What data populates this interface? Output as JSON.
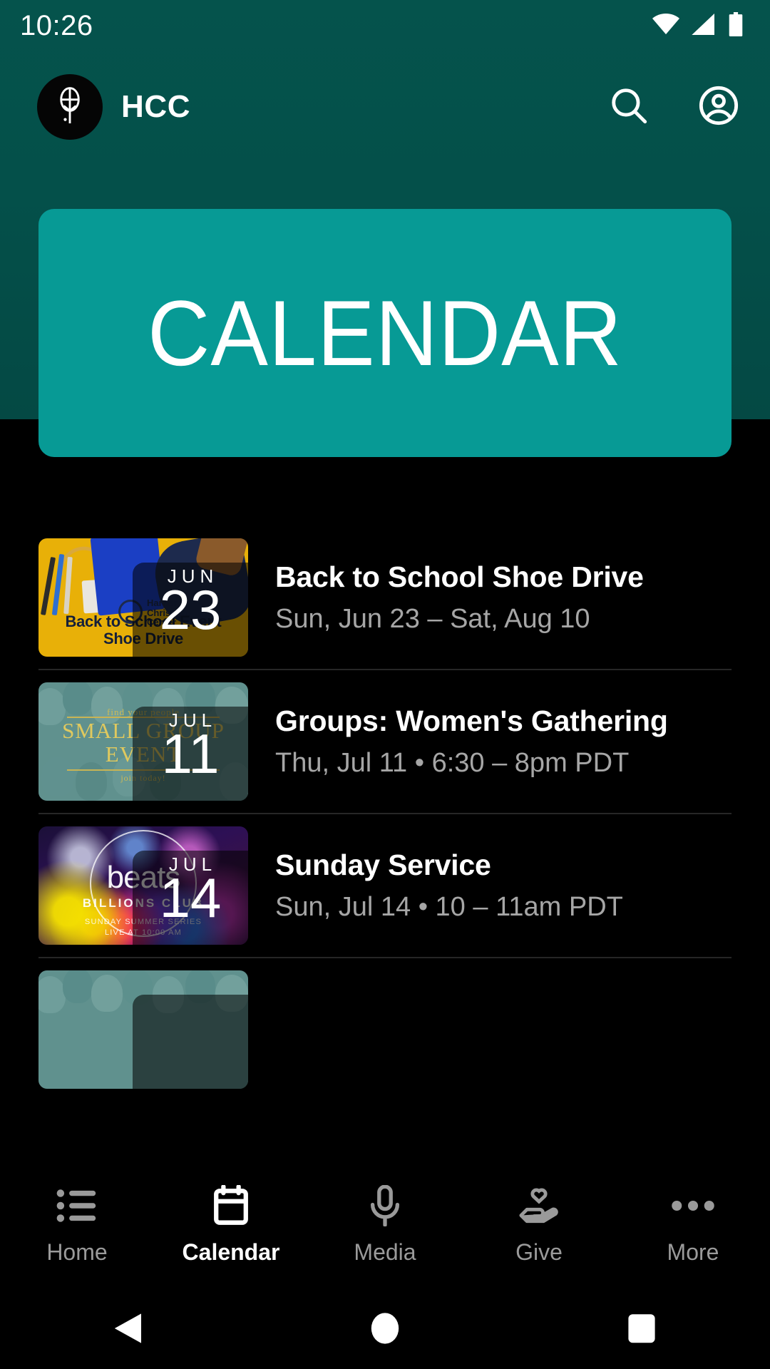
{
  "status_bar": {
    "time": "10:26",
    "icons": [
      "wifi-icon",
      "cellular-signal-icon",
      "battery-icon"
    ]
  },
  "app_bar": {
    "logo_icon": "church-tree-logo-icon",
    "title": "HCC",
    "search_icon": "search-icon",
    "account_icon": "account-circle-icon"
  },
  "banner": {
    "title": "CALENDAR",
    "background_color": "#079a95"
  },
  "theme": {
    "header_background": "#04504a",
    "page_background": "#000000",
    "accent": "#079a95",
    "secondary_text": "#a6a6a6",
    "divider": "#262626"
  },
  "events": [
    {
      "title": "Back to School Shoe Drive",
      "subtitle": "Sun, Jun 23 – Sat, Aug 10",
      "month": "JUN",
      "day": "23",
      "thumbnail": {
        "name": "back-to-school-shoe-drive-thumbnail",
        "headline": "Back to School Event\nShoe Drive",
        "logo_text": "Harbor\nChristian\nCenter"
      }
    },
    {
      "title": "Groups: Women's Gathering",
      "subtitle": "Thu, Jul 11 • 6:30 – 8pm PDT",
      "month": "JUL",
      "day": "11",
      "thumbnail": {
        "name": "small-group-event-thumbnail",
        "top_text": "find your people",
        "headline": "SMALL GROUP\nEVENT",
        "bottom_text": "join today!"
      }
    },
    {
      "title": "Sunday Service",
      "subtitle": "Sun, Jul 14 • 10 – 11am PDT",
      "month": "JUL",
      "day": "14",
      "thumbnail": {
        "name": "beats-billions-club-thumbnail",
        "word": "beats",
        "sub": "BILLIONS CLUB",
        "foot": "SUNDAY SUMMER SERIES\nLIVE AT 10:00 AM"
      }
    },
    {
      "title": "",
      "subtitle": "",
      "month": "",
      "day": "",
      "thumbnail": {
        "name": "partially-visible-event-thumbnail"
      }
    }
  ],
  "bottom_nav": {
    "active": "Calendar",
    "items": [
      {
        "label": "Home",
        "icon": "list-icon"
      },
      {
        "label": "Calendar",
        "icon": "calendar-icon"
      },
      {
        "label": "Media",
        "icon": "microphone-icon"
      },
      {
        "label": "Give",
        "icon": "hand-heart-icon"
      },
      {
        "label": "More",
        "icon": "more-horizontal-icon"
      }
    ]
  },
  "system_nav": {
    "back": "back-triangle-icon",
    "home": "home-circle-icon",
    "recents": "recents-square-icon"
  }
}
